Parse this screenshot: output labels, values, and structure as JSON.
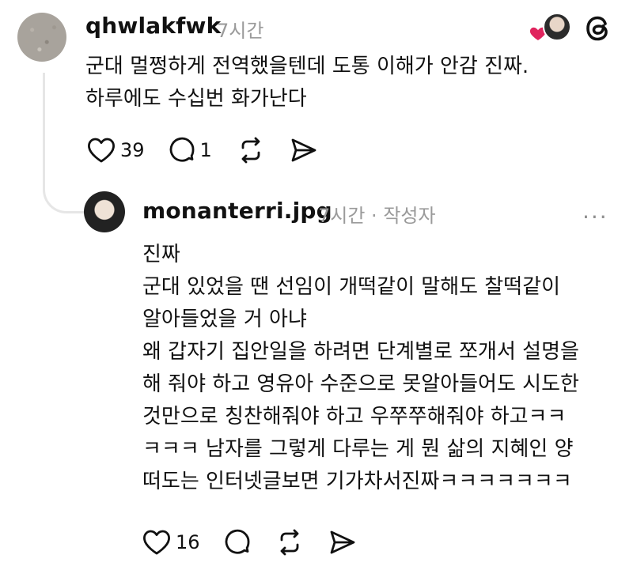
{
  "comment": {
    "username": "qhwlakfwk",
    "time": "7시간",
    "lines": [
      "군대 멀쩡하게 전역했을텐데 도통 이해가 안감 진짜.",
      "하루에도 수십번 화가난다"
    ],
    "likes": "39",
    "replies": "1"
  },
  "reply": {
    "username": "monanterri.jpg",
    "time": "7시간 · 작성자",
    "more": "···",
    "lines": [
      "진짜",
      "군대 있었을 땐 선임이 개떡같이 말해도 찰떡같이",
      "알아들었을 거 아냐",
      "왜 갑자기 집안일을 하려면 단계별로 쪼개서 설명을",
      "해 줘야 하고 영유아 수준으로 못알아들어도 시도한",
      "것만으로 칭찬해줘야 하고 우쭈쭈해줘야 하고ㅋㅋ",
      "ㅋㅋㅋ 남자를 그렇게 다루는 게 뭔 삶의 지혜인 양",
      "떠도는 인터넷글보면 기가차서진짜ㅋㅋㅋㅋㅋㅋㅋ"
    ],
    "likes": "16"
  },
  "colors": {
    "heart_badge": "#e0245e",
    "text": "#111111",
    "muted": "#9a9a9a",
    "thread_line": "#e6e6e6"
  },
  "icons": [
    "heart-icon",
    "comment-icon",
    "repost-icon",
    "share-icon",
    "threads-logo-icon",
    "more-icon"
  ]
}
